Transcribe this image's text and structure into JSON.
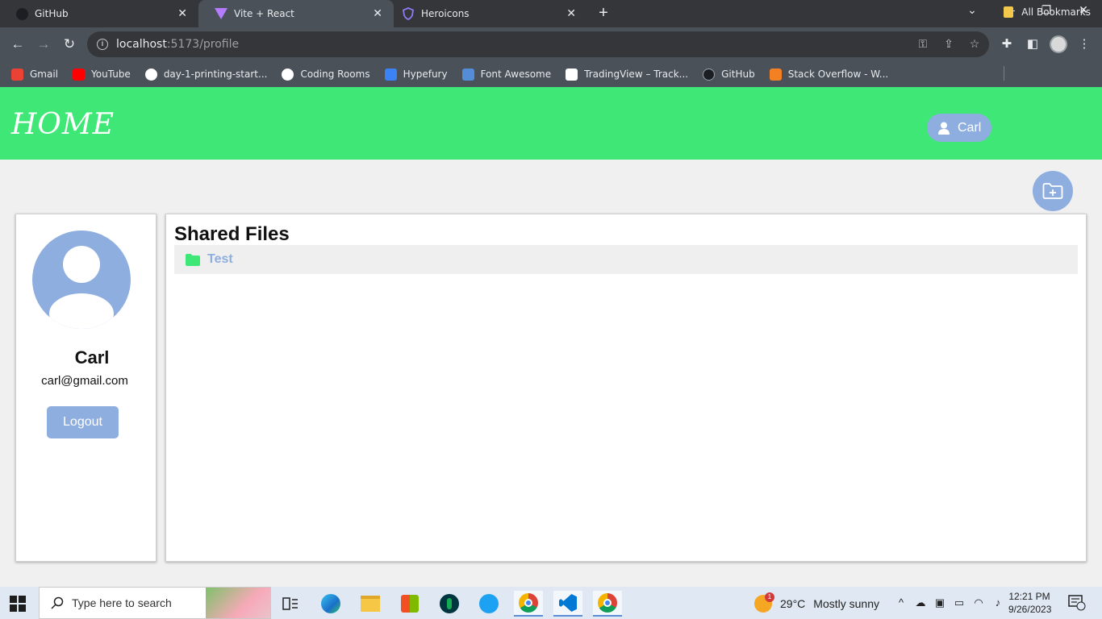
{
  "browser": {
    "tabs": [
      {
        "title": "GitHub",
        "active": false
      },
      {
        "title": "Vite + React",
        "active": true
      },
      {
        "title": "Heroicons",
        "active": false
      }
    ],
    "url_host": "localhost",
    "url_path": ":5173/profile",
    "bookmarks": [
      {
        "label": "Gmail",
        "icon": "gmail-icon",
        "color": "#ea4335"
      },
      {
        "label": "YouTube",
        "icon": "youtube-icon",
        "color": "#ff0000"
      },
      {
        "label": "day-1-printing-start...",
        "icon": "circle-icon",
        "color": "#ffffff"
      },
      {
        "label": "Coding Rooms",
        "icon": "coding-rooms-icon",
        "color": "#4a90e2"
      },
      {
        "label": "Hypefury",
        "icon": "hypefury-icon",
        "color": "#3b82f6"
      },
      {
        "label": "Font Awesome",
        "icon": "flag-icon",
        "color": "#538dd7"
      },
      {
        "label": "TradingView – Track...",
        "icon": "tradingview-icon",
        "color": "#131722"
      },
      {
        "label": "GitHub",
        "icon": "github-icon",
        "color": "#24292e"
      },
      {
        "label": "Stack Overflow - W...",
        "icon": "stackoverflow-icon",
        "color": "#f48024"
      }
    ],
    "all_bookmarks": "All Bookmarks"
  },
  "app": {
    "logo": "HOME",
    "user_chip": "Carl",
    "accent_green": "#3fe876",
    "accent_blue": "#8eaee0"
  },
  "profile": {
    "name": "Carl",
    "email": "carl@gmail.com",
    "logout_label": "Logout"
  },
  "files": {
    "title": "Shared Files",
    "items": [
      {
        "name": "Test",
        "icon": "folder-icon"
      }
    ]
  },
  "taskbar": {
    "search_placeholder": "Type here to search",
    "weather_temp": "29°C",
    "weather_condition": "Mostly sunny",
    "weather_badge": "1",
    "time": "12:21 PM",
    "date": "9/26/2023"
  }
}
